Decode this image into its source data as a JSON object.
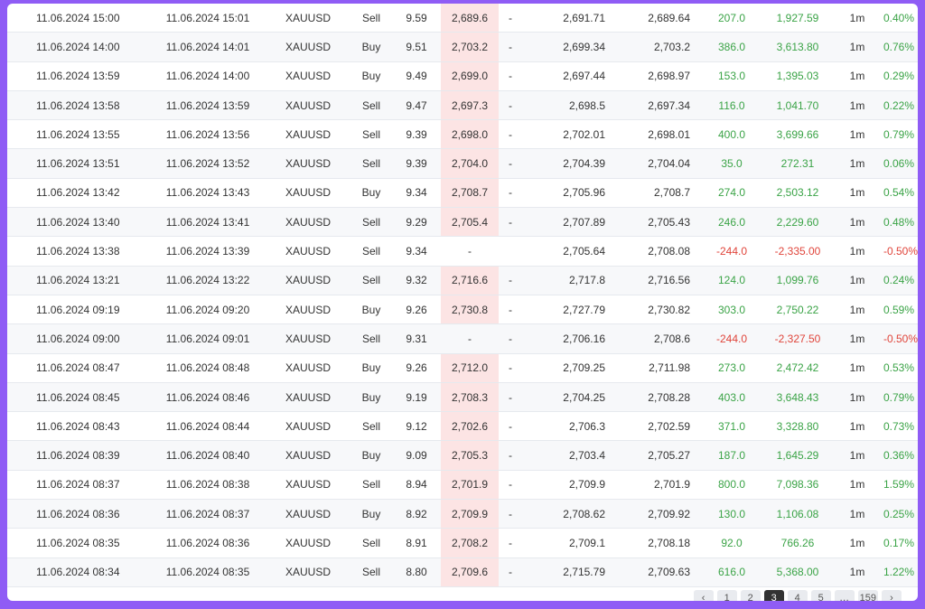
{
  "trades": [
    {
      "open": "11.06.2024 15:00",
      "close": "11.06.2024 15:01",
      "symbol": "XAUUSD",
      "side": "Sell",
      "lot": "9.59",
      "sl": "2,689.6",
      "tp": "-",
      "entry": "2,691.71",
      "exit": "2,689.64",
      "pips": "207.0",
      "pnl": "1,927.59",
      "tf": "1m",
      "pct": "0.40%",
      "status": "pos"
    },
    {
      "open": "11.06.2024 14:00",
      "close": "11.06.2024 14:01",
      "symbol": "XAUUSD",
      "side": "Buy",
      "lot": "9.51",
      "sl": "2,703.2",
      "tp": "-",
      "entry": "2,699.34",
      "exit": "2,703.2",
      "pips": "386.0",
      "pnl": "3,613.80",
      "tf": "1m",
      "pct": "0.76%",
      "status": "pos"
    },
    {
      "open": "11.06.2024 13:59",
      "close": "11.06.2024 14:00",
      "symbol": "XAUUSD",
      "side": "Buy",
      "lot": "9.49",
      "sl": "2,699.0",
      "tp": "-",
      "entry": "2,697.44",
      "exit": "2,698.97",
      "pips": "153.0",
      "pnl": "1,395.03",
      "tf": "1m",
      "pct": "0.29%",
      "status": "pos"
    },
    {
      "open": "11.06.2024 13:58",
      "close": "11.06.2024 13:59",
      "symbol": "XAUUSD",
      "side": "Sell",
      "lot": "9.47",
      "sl": "2,697.3",
      "tp": "-",
      "entry": "2,698.5",
      "exit": "2,697.34",
      "pips": "116.0",
      "pnl": "1,041.70",
      "tf": "1m",
      "pct": "0.22%",
      "status": "pos"
    },
    {
      "open": "11.06.2024 13:55",
      "close": "11.06.2024 13:56",
      "symbol": "XAUUSD",
      "side": "Sell",
      "lot": "9.39",
      "sl": "2,698.0",
      "tp": "-",
      "entry": "2,702.01",
      "exit": "2,698.01",
      "pips": "400.0",
      "pnl": "3,699.66",
      "tf": "1m",
      "pct": "0.79%",
      "status": "pos"
    },
    {
      "open": "11.06.2024 13:51",
      "close": "11.06.2024 13:52",
      "symbol": "XAUUSD",
      "side": "Sell",
      "lot": "9.39",
      "sl": "2,704.0",
      "tp": "-",
      "entry": "2,704.39",
      "exit": "2,704.04",
      "pips": "35.0",
      "pnl": "272.31",
      "tf": "1m",
      "pct": "0.06%",
      "status": "pos"
    },
    {
      "open": "11.06.2024 13:42",
      "close": "11.06.2024 13:43",
      "symbol": "XAUUSD",
      "side": "Buy",
      "lot": "9.34",
      "sl": "2,708.7",
      "tp": "-",
      "entry": "2,705.96",
      "exit": "2,708.7",
      "pips": "274.0",
      "pnl": "2,503.12",
      "tf": "1m",
      "pct": "0.54%",
      "status": "pos"
    },
    {
      "open": "11.06.2024 13:40",
      "close": "11.06.2024 13:41",
      "symbol": "XAUUSD",
      "side": "Sell",
      "lot": "9.29",
      "sl": "2,705.4",
      "tp": "-",
      "entry": "2,707.89",
      "exit": "2,705.43",
      "pips": "246.0",
      "pnl": "2,229.60",
      "tf": "1m",
      "pct": "0.48%",
      "status": "pos"
    },
    {
      "open": "11.06.2024 13:38",
      "close": "11.06.2024 13:39",
      "symbol": "XAUUSD",
      "side": "Sell",
      "lot": "9.34",
      "sl": "-",
      "tp": "",
      "entry": "2,705.64",
      "exit": "2,708.08",
      "pips": "-244.0",
      "pnl": "-2,335.00",
      "tf": "1m",
      "pct": "-0.50%",
      "status": "neg"
    },
    {
      "open": "11.06.2024 13:21",
      "close": "11.06.2024 13:22",
      "symbol": "XAUUSD",
      "side": "Sell",
      "lot": "9.32",
      "sl": "2,716.6",
      "tp": "-",
      "entry": "2,717.8",
      "exit": "2,716.56",
      "pips": "124.0",
      "pnl": "1,099.76",
      "tf": "1m",
      "pct": "0.24%",
      "status": "pos"
    },
    {
      "open": "11.06.2024 09:19",
      "close": "11.06.2024 09:20",
      "symbol": "XAUUSD",
      "side": "Buy",
      "lot": "9.26",
      "sl": "2,730.8",
      "tp": "-",
      "entry": "2,727.79",
      "exit": "2,730.82",
      "pips": "303.0",
      "pnl": "2,750.22",
      "tf": "1m",
      "pct": "0.59%",
      "status": "pos"
    },
    {
      "open": "11.06.2024 09:00",
      "close": "11.06.2024 09:01",
      "symbol": "XAUUSD",
      "side": "Sell",
      "lot": "9.31",
      "sl": "-",
      "tp": "-",
      "entry": "2,706.16",
      "exit": "2,708.6",
      "pips": "-244.0",
      "pnl": "-2,327.50",
      "tf": "1m",
      "pct": "-0.50%",
      "status": "neg"
    },
    {
      "open": "11.06.2024 08:47",
      "close": "11.06.2024 08:48",
      "symbol": "XAUUSD",
      "side": "Buy",
      "lot": "9.26",
      "sl": "2,712.0",
      "tp": "-",
      "entry": "2,709.25",
      "exit": "2,711.98",
      "pips": "273.0",
      "pnl": "2,472.42",
      "tf": "1m",
      "pct": "0.53%",
      "status": "pos"
    },
    {
      "open": "11.06.2024 08:45",
      "close": "11.06.2024 08:46",
      "symbol": "XAUUSD",
      "side": "Buy",
      "lot": "9.19",
      "sl": "2,708.3",
      "tp": "-",
      "entry": "2,704.25",
      "exit": "2,708.28",
      "pips": "403.0",
      "pnl": "3,648.43",
      "tf": "1m",
      "pct": "0.79%",
      "status": "pos"
    },
    {
      "open": "11.06.2024 08:43",
      "close": "11.06.2024 08:44",
      "symbol": "XAUUSD",
      "side": "Sell",
      "lot": "9.12",
      "sl": "2,702.6",
      "tp": "-",
      "entry": "2,706.3",
      "exit": "2,702.59",
      "pips": "371.0",
      "pnl": "3,328.80",
      "tf": "1m",
      "pct": "0.73%",
      "status": "pos"
    },
    {
      "open": "11.06.2024 08:39",
      "close": "11.06.2024 08:40",
      "symbol": "XAUUSD",
      "side": "Buy",
      "lot": "9.09",
      "sl": "2,705.3",
      "tp": "-",
      "entry": "2,703.4",
      "exit": "2,705.27",
      "pips": "187.0",
      "pnl": "1,645.29",
      "tf": "1m",
      "pct": "0.36%",
      "status": "pos"
    },
    {
      "open": "11.06.2024 08:37",
      "close": "11.06.2024 08:38",
      "symbol": "XAUUSD",
      "side": "Sell",
      "lot": "8.94",
      "sl": "2,701.9",
      "tp": "-",
      "entry": "2,709.9",
      "exit": "2,701.9",
      "pips": "800.0",
      "pnl": "7,098.36",
      "tf": "1m",
      "pct": "1.59%",
      "status": "pos"
    },
    {
      "open": "11.06.2024 08:36",
      "close": "11.06.2024 08:37",
      "symbol": "XAUUSD",
      "side": "Buy",
      "lot": "8.92",
      "sl": "2,709.9",
      "tp": "-",
      "entry": "2,708.62",
      "exit": "2,709.92",
      "pips": "130.0",
      "pnl": "1,106.08",
      "tf": "1m",
      "pct": "0.25%",
      "status": "pos"
    },
    {
      "open": "11.06.2024 08:35",
      "close": "11.06.2024 08:36",
      "symbol": "XAUUSD",
      "side": "Sell",
      "lot": "8.91",
      "sl": "2,708.2",
      "tp": "-",
      "entry": "2,709.1",
      "exit": "2,708.18",
      "pips": "92.0",
      "pnl": "766.26",
      "tf": "1m",
      "pct": "0.17%",
      "status": "pos"
    },
    {
      "open": "11.06.2024 08:34",
      "close": "11.06.2024 08:35",
      "symbol": "XAUUSD",
      "side": "Sell",
      "lot": "8.80",
      "sl": "2,709.6",
      "tp": "-",
      "entry": "2,715.79",
      "exit": "2,709.63",
      "pips": "616.0",
      "pnl": "5,368.00",
      "tf": "1m",
      "pct": "1.22%",
      "status": "pos"
    }
  ],
  "pagination": {
    "items": [
      "‹",
      "1",
      "2",
      "3",
      "4",
      "5",
      "…",
      "159",
      "›"
    ],
    "active_index": 3
  },
  "colors": {
    "frame": "#8f5cf5",
    "positive": "#3aa346",
    "negative": "#e0453b",
    "sl_highlight": "#fce4e4"
  }
}
